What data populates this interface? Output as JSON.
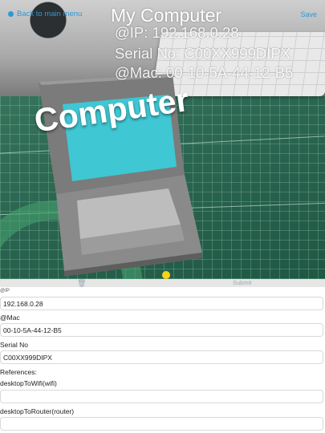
{
  "navigation": {
    "back_label": "Back to main menu",
    "save_label": "Save"
  },
  "ar_overlay": {
    "title": "My Computer",
    "ip_line": "@IP: 192.168.0.28",
    "serial_line": "Serial No: C00XX999DIPX",
    "mac_line": "@Mac: 00-10-5A-44-12-B5",
    "object_label": "Computer"
  },
  "toolbar": {
    "delete_icon": "trash-icon",
    "submit_label": "Submit"
  },
  "form": {
    "ip": {
      "label": "@IP",
      "value": "192.168.0.28"
    },
    "mac": {
      "label": "@Mac",
      "value": "00-10-5A-44-12-B5"
    },
    "serial": {
      "label": "Serial No",
      "value": "C00XX999DIPX"
    },
    "references_label": "References:",
    "references": [
      {
        "label": "desktopToWifi(wifi)",
        "value": ""
      },
      {
        "label": "desktopToRouter(router)",
        "value": ""
      }
    ]
  },
  "colors": {
    "link": "#2c9ad8",
    "toolbar_bg": "#e6e6e6",
    "screen": "#3fc7d3"
  }
}
